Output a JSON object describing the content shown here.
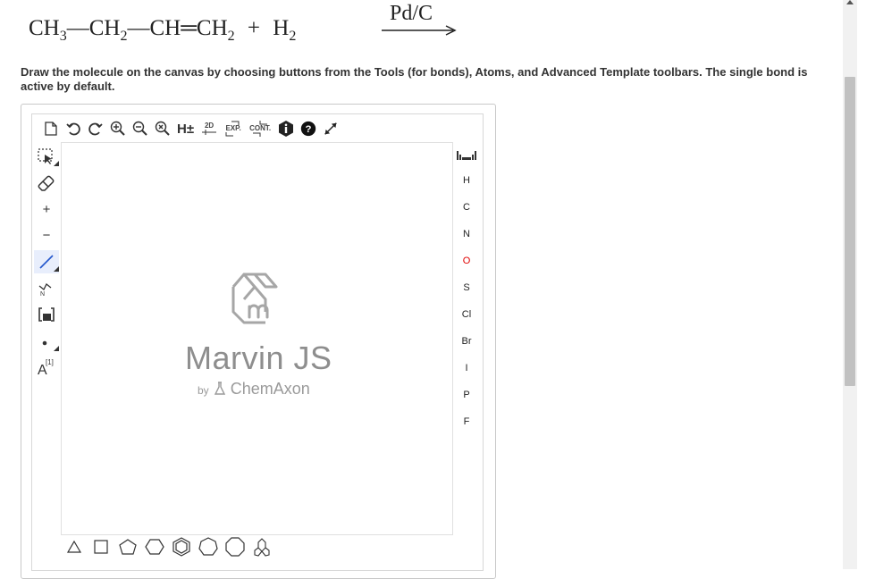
{
  "equation": {
    "reactant_1": [
      "CH",
      "3",
      "—CH",
      "2",
      "—CH═CH",
      "2"
    ],
    "plus": "+",
    "reactant_2": [
      "H",
      "2"
    ],
    "catalyst": "Pd/C"
  },
  "instructions": "Draw the molecule on the canvas by choosing buttons from the Tools (for bonds), Atoms, and Advanced Template toolbars. The single bond is active by default.",
  "toolbar": {
    "hydrogen_label": "H±",
    "twod_label": "2D",
    "expand_label": "EXP.",
    "contract_label": "CONT."
  },
  "left_tools": {
    "charge_plus": "+",
    "charge_minus": "−",
    "atom_map_label": "A",
    "atom_map_index": "[1]"
  },
  "atoms": [
    "H",
    "C",
    "N",
    "O",
    "S",
    "Cl",
    "Br",
    "I",
    "P",
    "F"
  ],
  "atom_colors": {
    "O": "#e00000",
    "default": "#333333"
  },
  "logo": {
    "name": "Marvin JS",
    "by": "by",
    "company": "ChemAxon"
  }
}
